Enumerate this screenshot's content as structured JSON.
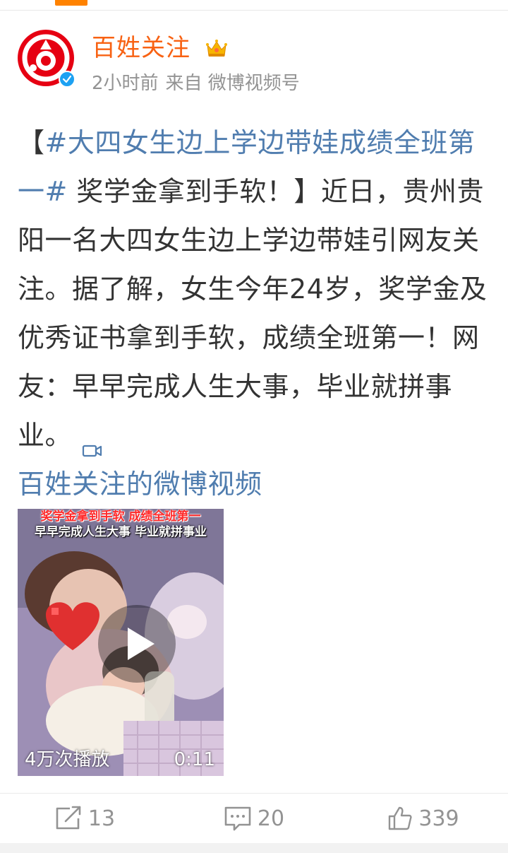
{
  "post": {
    "author": "百姓关注",
    "time": "2小时前",
    "source": "来自 微博视频号",
    "text": {
      "open_bracket": "【",
      "topic": "#大四女生边上学边带娃成绩全班第一#",
      "headline_rest": " 奖学金拿到手软！】",
      "body": "近日，贵州贵阳一名大四女生边上学边带娃引网友关注。据了解，女生今年24岁，奖学金及优秀证书拿到手软，成绩全班第一！网友：早早完成人生大事，毕业就拼事业。",
      "video_link": "百姓关注的微博视频"
    },
    "video": {
      "caption_line1": "奖学金拿到手软 成绩全班第一",
      "caption_line2": "早早完成人生大事 毕业就拼事业",
      "play_count": "4万次播放",
      "duration": "0:11"
    },
    "actions": {
      "repost_count": "13",
      "comment_count": "20",
      "like_count": "339"
    }
  },
  "colors": {
    "accent_orange": "#f86213",
    "link_blue": "#507daf",
    "meta_gray": "#939393",
    "avatar_red": "#e60012",
    "verified_blue": "#1da1f2"
  },
  "icons": {
    "verified": "verified-badge-icon",
    "crown": "crown-icon",
    "video_link": "video-camera-icon",
    "play": "play-icon",
    "repost": "repost-icon",
    "comment": "comment-icon",
    "like": "thumbs-up-icon"
  }
}
